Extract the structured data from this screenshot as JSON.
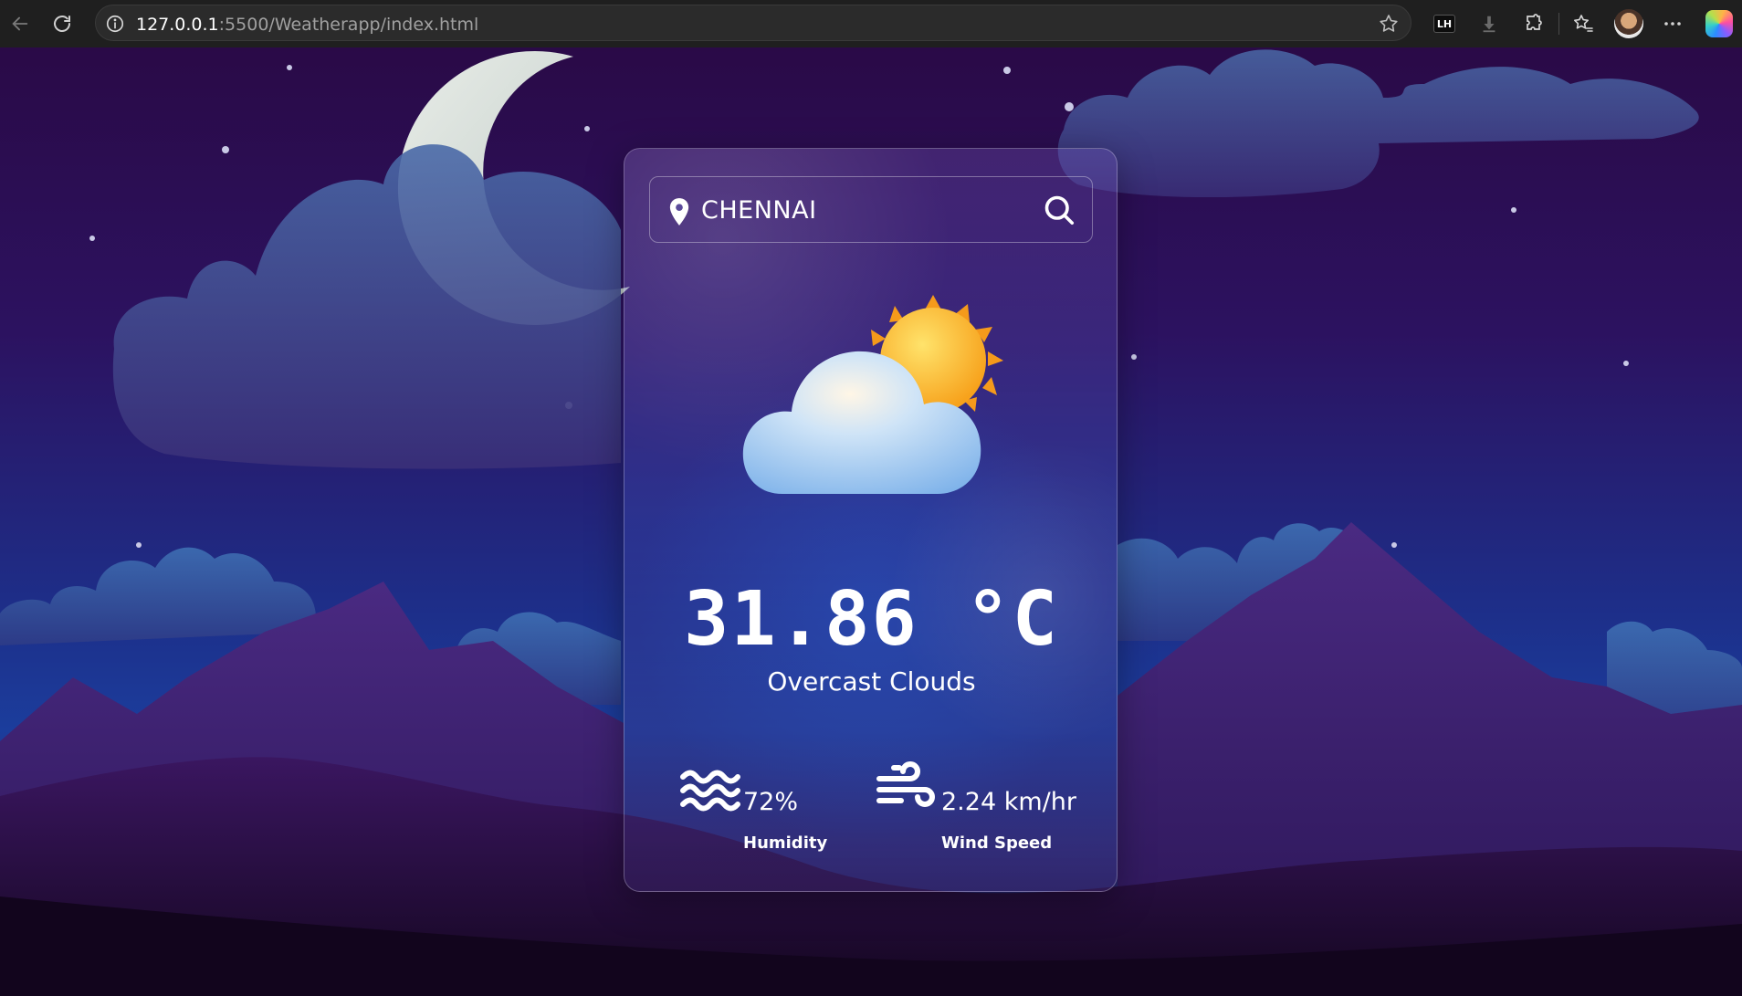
{
  "browser": {
    "url_host": "127.0.0.1",
    "url_rest": ":5500/Weatherapp/index.html",
    "extension_badge": "LH"
  },
  "app": {
    "search": {
      "value": "CHENNAI",
      "placeholder": ""
    },
    "weather": {
      "icon": "cloud-sun-icon",
      "temperature": "31.86 °C",
      "description": "Overcast Clouds"
    },
    "humidity": {
      "value": "72%",
      "label": "Humidity",
      "icon": "water-waves-icon"
    },
    "wind": {
      "value": "2.24 km/hr",
      "label": "Wind Speed",
      "icon": "wind-icon"
    }
  },
  "colors": {
    "sky_top": "#2a0a47",
    "sky_mid": "#1d2f8a",
    "mountain": "#3a1a66",
    "cloud": "#3e4f8f"
  }
}
